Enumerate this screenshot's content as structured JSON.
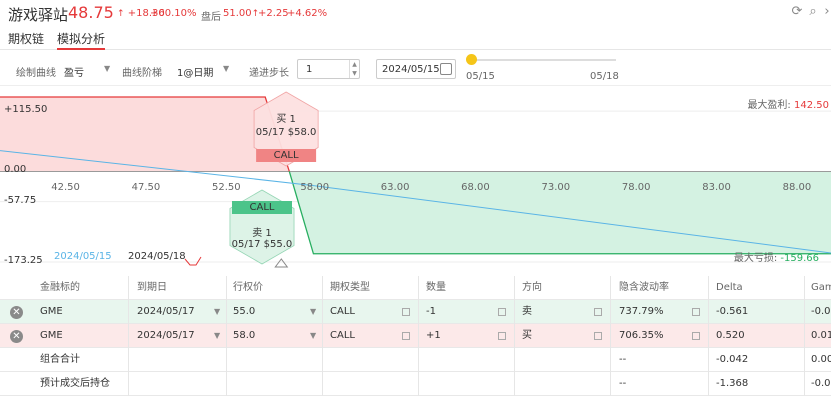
{
  "header": {
    "name": "游戏驿站",
    "price": "48.75",
    "change": "+18.30",
    "percent": "+60.10%",
    "after_hours_label": "盘后",
    "after_hours_price": "51.00",
    "after_hours_change": "+2.25",
    "after_hours_percent": "+4.62%",
    "up_arrow": "↑",
    "icons": [
      "refresh-icon",
      "search-icon",
      "collapse-icon"
    ]
  },
  "tabs": [
    {
      "label": "期权链",
      "active": false
    },
    {
      "label": "模拟分析",
      "active": true
    }
  ],
  "controls": {
    "curve_label": "绘制曲线",
    "curve_value": "盈亏",
    "ladder_label": "曲线阶梯",
    "ladder_value": "1@日期",
    "step_label": "递进步长",
    "step_value": "1",
    "date_value": "2024/05/15",
    "slider_start": "05/15",
    "slider_end": "05/18"
  },
  "colors": {
    "up": "#e5393a",
    "down": "#27ae60",
    "today_line": "#5ab4e6",
    "loss_fill": "#d4f2e2",
    "profit_fill": "#fcdcdc",
    "knob": "#f5c518"
  },
  "chart": {
    "max_profit_label": "最大盈利:",
    "max_profit_value": "142.50",
    "max_loss_label": "最大亏损:",
    "max_loss_value": "-159.66",
    "legend_today": "2024/05/15",
    "legend_expiry": "2024/05/18"
  },
  "chart_data": {
    "type": "line",
    "ylabels": [
      "+115.50",
      "0.00",
      "-57.75",
      "-173.25"
    ],
    "yticks": [
      115.5,
      0,
      -57.75,
      -173.25
    ],
    "ylim": [
      -173.25,
      142.5
    ],
    "xlabels": [
      "42.50",
      "47.50",
      "52.50",
      "58.00",
      "63.00",
      "68.00",
      "73.00",
      "78.00",
      "83.00",
      "88.00"
    ],
    "xlim": [
      38.5,
      90.2
    ],
    "series": [
      {
        "name": "2024/05/18",
        "points": [
          [
            38.5,
            142.5
          ],
          [
            55.0,
            142.5
          ],
          [
            56.5,
            0
          ],
          [
            58.0,
            -157.5
          ],
          [
            90.2,
            -157.5
          ]
        ]
      },
      {
        "name": "2024/05/15",
        "points": [
          [
            38.5,
            40
          ],
          [
            58.0,
            -27
          ],
          [
            90.2,
            -156
          ]
        ]
      }
    ],
    "annotations": [
      {
        "side": "买 1",
        "contract": "05/17 $58.0",
        "type": "CALL"
      },
      {
        "side": "卖 1",
        "contract": "05/17 $55.0",
        "type": "CALL"
      }
    ]
  },
  "table": {
    "headers": [
      "金融标的",
      "到期日",
      "行权价",
      "期权类型",
      "数量",
      "方向",
      "隐含波动率",
      "Delta",
      "Gam"
    ],
    "rows": [
      {
        "symbol": "GME",
        "expiry": "2024/05/17",
        "strike": "55.0",
        "type": "CALL",
        "qty": "-1",
        "side": "卖",
        "iv": "737.79%",
        "delta": "-0.561",
        "gamma": "-0.0"
      },
      {
        "symbol": "GME",
        "expiry": "2024/05/17",
        "strike": "58.0",
        "type": "CALL",
        "qty": "+1",
        "side": "买",
        "iv": "706.35%",
        "delta": "0.520",
        "gamma": "0.01"
      }
    ],
    "summary": [
      {
        "label": "组合合计",
        "iv": "--",
        "delta": "-0.042",
        "gamma": "0.00"
      },
      {
        "label": "预计成交后持仓",
        "iv": "--",
        "delta": "-1.368",
        "gamma": "-0.0"
      }
    ]
  }
}
